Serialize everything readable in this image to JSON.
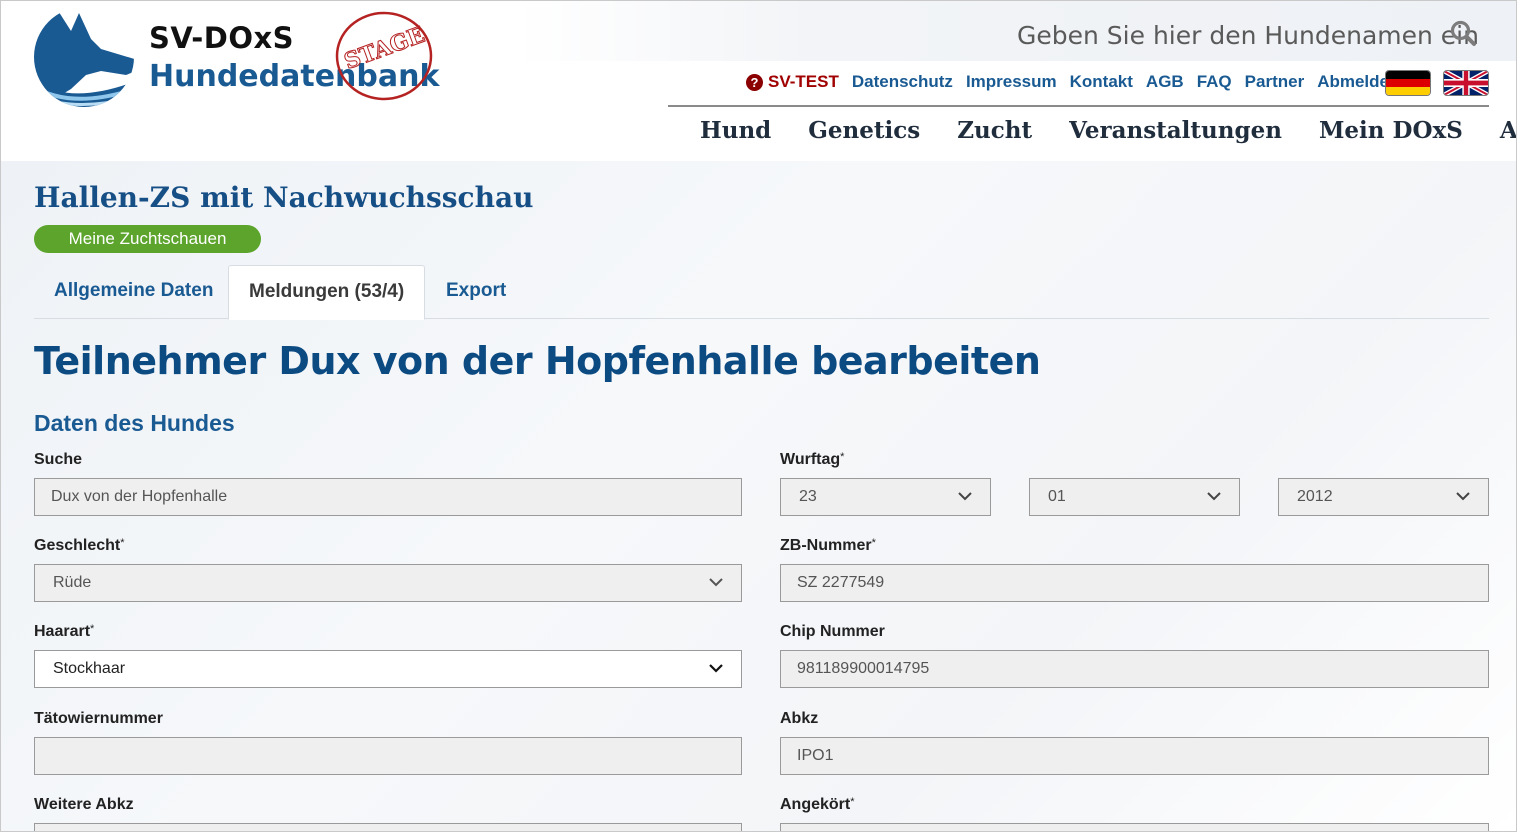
{
  "header": {
    "logo_line1": "SV-DOxS",
    "logo_line2": "Hundedatenbank",
    "stamp_text": "STAGE",
    "search_placeholder": "Geben Sie hier den Hundenamen ein",
    "util_nav": [
      "SV-TEST",
      "Datenschutz",
      "Impressum",
      "Kontakt",
      "AGB",
      "FAQ",
      "Partner",
      "Abmelden"
    ],
    "main_nav": [
      "Hund",
      "Genetics",
      "Zucht",
      "Veranstaltungen",
      "Mein DOxS",
      "Admin"
    ],
    "colors": {
      "brand_blue": "#1a5a93",
      "test_red": "#a00000",
      "pill_green": "#5ca42c"
    }
  },
  "event": {
    "title": "Hallen-ZS mit Nachwuchsschau",
    "pill_label": "Meine Zuchtschauen"
  },
  "tabs": [
    {
      "label": "Allgemeine Daten",
      "active": false
    },
    {
      "label": "Meldungen (53/4)",
      "active": true
    },
    {
      "label": "Export",
      "active": false
    }
  ],
  "page_heading": "Teilnehmer Dux von der Hopfenhalle bearbeiten",
  "section_heading": "Daten des Hundes",
  "form": {
    "suche": {
      "label": "Suche",
      "value": "Dux von der Hopfenhalle"
    },
    "wurftag": {
      "label": "Wurftag",
      "required": "*",
      "day": "23",
      "month": "01",
      "year": "2012"
    },
    "geschlecht": {
      "label": "Geschlecht",
      "required": "*",
      "value": "Rüde"
    },
    "zb_nummer": {
      "label": "ZB-Nummer",
      "required": "*",
      "value": "SZ 2277549"
    },
    "haarart": {
      "label": "Haarart",
      "required": "*",
      "value": "Stockhaar"
    },
    "chip_nummer": {
      "label": "Chip Nummer",
      "value": "981189900014795"
    },
    "taetowiernummer": {
      "label": "Tätowiernummer",
      "value": ""
    },
    "abkz": {
      "label": "Abkz",
      "value": "IPO1"
    },
    "weitere_abkz": {
      "label": "Weitere Abkz"
    },
    "angekoert": {
      "label": "Angekört",
      "required": "*"
    }
  }
}
